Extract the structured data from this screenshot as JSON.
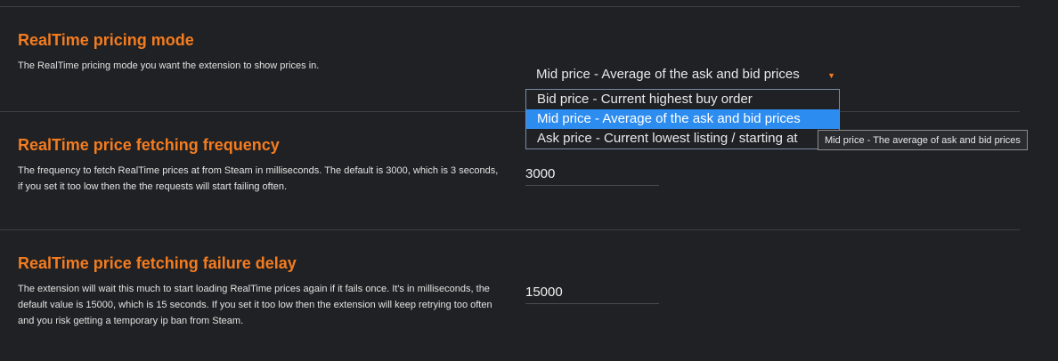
{
  "settings": {
    "pricing_mode": {
      "title": "RealTime pricing mode",
      "description": "The RealTime pricing mode you want the extension to show prices in.",
      "selected_value": "Mid price - Average of the ask and bid prices",
      "options": [
        "Bid price - Current highest buy order",
        "Mid price - Average of the ask and bid prices",
        "Ask price - Current lowest listing / starting at"
      ],
      "highlighted_option_index": 1,
      "tooltip": "Mid price - The average of ask and bid prices"
    },
    "fetch_frequency": {
      "title": "RealTime price fetching frequency",
      "description": "The frequency to fetch RealTime prices at from Steam in milliseconds. The default is 3000, which is 3 seconds, if you set it too low then the the requests will start failing often.",
      "value": "3000"
    },
    "failure_delay": {
      "title": "RealTime price fetching failure delay",
      "description": "The extension will wait this much to start loading RealTime prices again if it fails once. It's in milliseconds, the default value is 15000, which is 15 seconds. If you set it too low then the extension will keep retrying too often and you risk getting a temporary ip ban from Steam.",
      "value": "15000"
    }
  },
  "icons": {
    "dropdown_arrow": "caret-down-icon"
  },
  "colors": {
    "background": "#202124",
    "accent": "#f47c20",
    "selection": "#2d8cf0",
    "text": "#e2e2e2"
  }
}
